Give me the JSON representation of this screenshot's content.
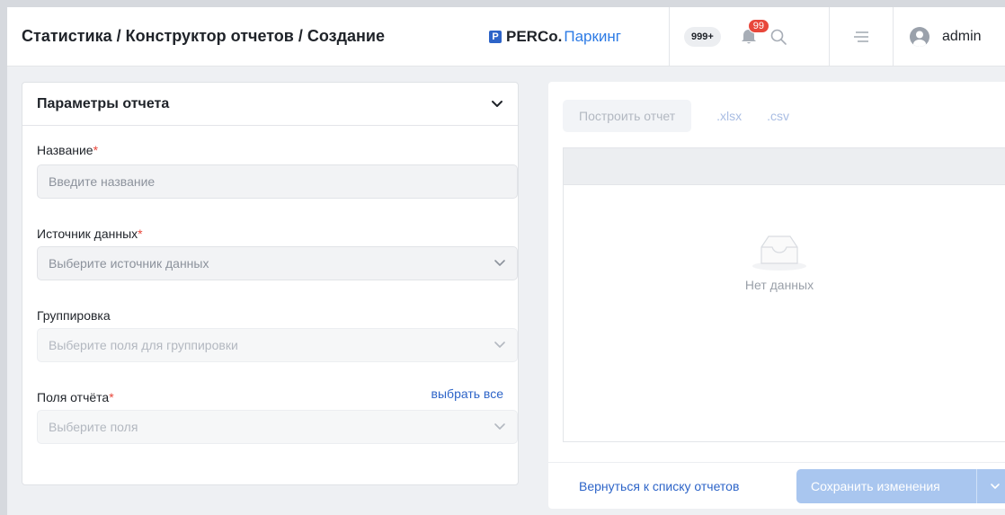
{
  "header": {
    "title": "Статистика / Конструктор отчетов / Создание",
    "brand_mark": "P",
    "brand_name": "PERCo.",
    "brand_product": "Паркинг",
    "count_badge": "999+",
    "notifications_count": "99",
    "user_name": "admin"
  },
  "params": {
    "title": "Параметры отчета",
    "fields": {
      "name": {
        "label": "Название",
        "required_mark": "*",
        "placeholder": "Введите название"
      },
      "source": {
        "label": "Источник данных",
        "required_mark": "*",
        "placeholder": "Выберите источник данных"
      },
      "grouping": {
        "label": "Группировка",
        "placeholder": "Выберите поля для группировки"
      },
      "fields": {
        "label": "Поля отчёта",
        "required_mark": "*",
        "placeholder": "Выберите поля",
        "select_all": "выбрать все"
      }
    }
  },
  "report": {
    "build_label": "Построить отчет",
    "xlsx_label": ".xlsx",
    "csv_label": ".csv",
    "empty_text": "Нет данных",
    "back_label": "Вернуться к списку отчетов",
    "save_label": "Сохранить изменения"
  },
  "colors": {
    "accent": "#2d64c8",
    "required": "#e8473b",
    "save_disabled": "#a9c6ef"
  }
}
